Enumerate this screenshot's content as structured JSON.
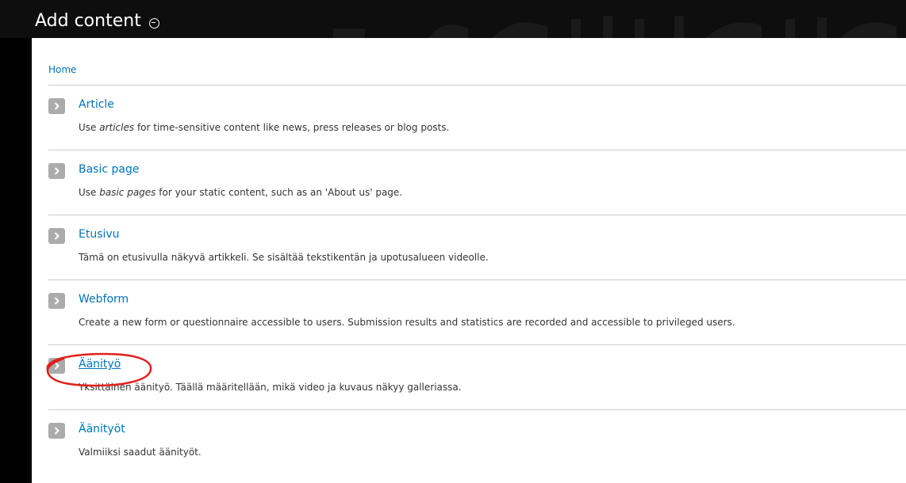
{
  "header": {
    "title": "Add content"
  },
  "breadcrumb": {
    "home": "Home"
  },
  "content_types": [
    {
      "title": "Article",
      "desc_pre": "Use ",
      "desc_em": "articles",
      "desc_post": " for time-sensitive content like news, press releases or blog posts."
    },
    {
      "title": "Basic page",
      "desc_pre": "Use ",
      "desc_em": "basic pages",
      "desc_post": " for your static content, such as an 'About us' page."
    },
    {
      "title": "Etusivu",
      "desc": "Tämä on etusivulla näkyvä artikkeli. Se sisältää tekstikentän ja upotusalueen videolle."
    },
    {
      "title": "Webform",
      "desc": "Create a new form or questionnaire accessible to users. Submission results and statistics are recorded and accessible to privileged users."
    },
    {
      "title": "Äänityö",
      "desc": "Yksittäinen äänityö. Täällä määritellään, mikä video ja kuvaus näkyy galleriassa."
    },
    {
      "title": "Äänityöt",
      "desc": "Valmiiksi saadut äänityöt."
    }
  ],
  "colors": {
    "link": "#0074bd",
    "annotation": "#e0201c",
    "arrow_bg": "#ababab"
  }
}
